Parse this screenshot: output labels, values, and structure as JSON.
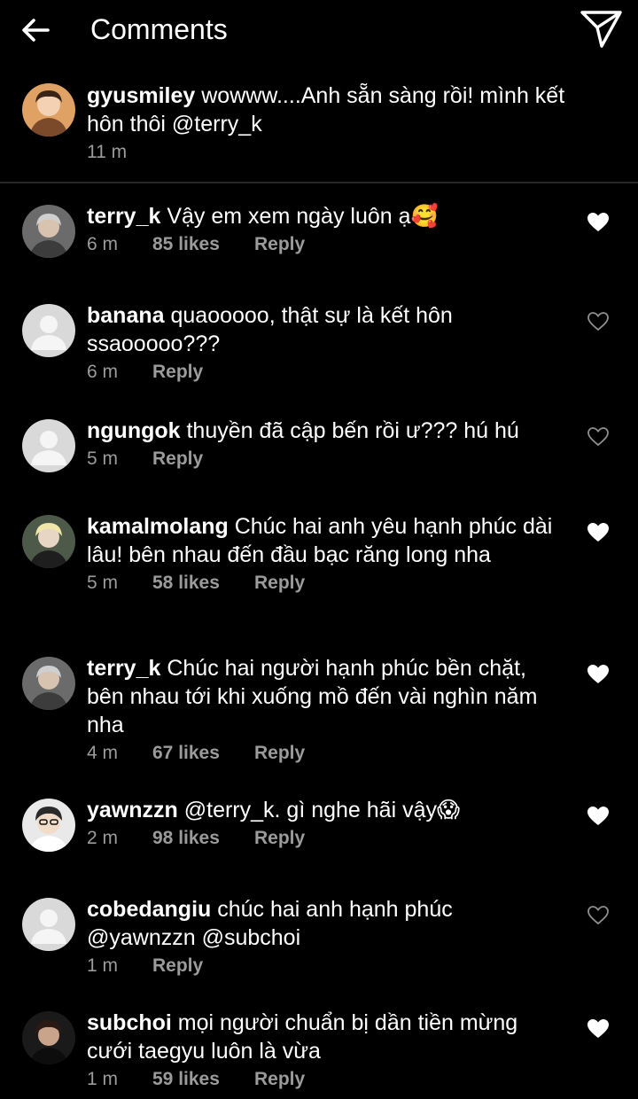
{
  "header": {
    "title": "Comments",
    "back_icon": "arrow-left-icon",
    "send_icon": "paper-plane-icon"
  },
  "caption": {
    "username": "gyusmiley",
    "text": "wowww....Anh sẵn sàng rồi! mình kết hôn thôi @terry_k",
    "time": "11 m"
  },
  "comments": [
    {
      "username": "terry_k",
      "text": "Vậy em xem ngày luôn ạ🥰",
      "time": "6 m",
      "likes": "85 likes",
      "reply": "Reply",
      "liked": true
    },
    {
      "username": "banana",
      "text": "quaooooo, thật sự là kết hôn ssaooooo???",
      "time": "6 m",
      "likes": "",
      "reply": "Reply",
      "liked": false
    },
    {
      "username": "ngungok",
      "text": "thuyền đã cập bến rồi ư??? hú hú",
      "time": "5 m",
      "likes": "",
      "reply": "Reply",
      "liked": false
    },
    {
      "username": "kamalmolang",
      "text": "Chúc hai anh yêu hạnh phúc dài lâu! bên nhau đến đầu bạc răng long nha",
      "time": "5 m",
      "likes": "58 likes",
      "reply": "Reply",
      "liked": true
    },
    {
      "username": "terry_k",
      "text": "Chúc hai người hạnh phúc bền chặt, bên nhau tới khi xuống mồ đến vài nghìn năm nha",
      "time": "4 m",
      "likes": "67 likes",
      "reply": "Reply",
      "liked": true
    },
    {
      "username": "yawnzzn",
      "text": "@terry_k. gì nghe hãi vậy😱",
      "time": "2 m",
      "likes": "98 likes",
      "reply": "Reply",
      "liked": true
    },
    {
      "username": "cobedangiu",
      "text": "chúc hai anh hạnh phúc @yawnzzn @subchoi",
      "time": "1 m",
      "likes": "",
      "reply": "Reply",
      "liked": false
    },
    {
      "username": "subchoi",
      "text": "mọi người chuẩn bị dần tiền mừng cưới taegyu luôn là vừa",
      "time": "1 m",
      "likes": "59 likes",
      "reply": "Reply",
      "liked": true
    }
  ],
  "colors": {
    "background": "#000000",
    "text": "#ffffff",
    "meta": "#9b9b9b",
    "divider": "#262626",
    "placeholder_avatar": "#d9d9d9"
  }
}
